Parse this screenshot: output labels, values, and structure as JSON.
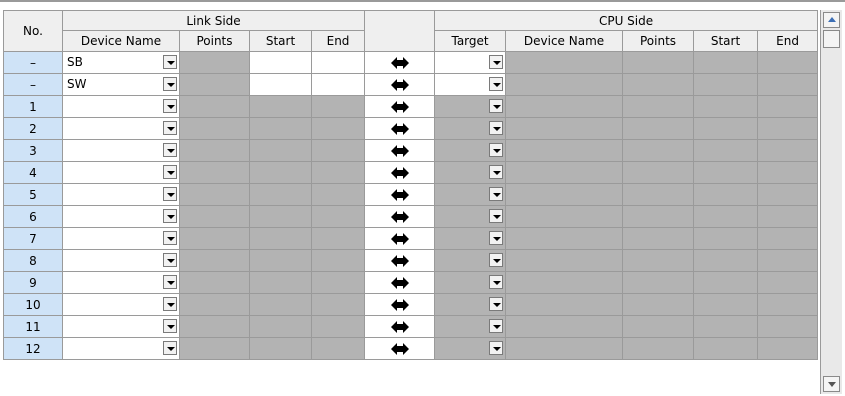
{
  "headers": {
    "no": "No.",
    "link_side": "Link Side",
    "cpu_side": "CPU Side",
    "link_cols": [
      "Device Name",
      "Points",
      "Start",
      "End"
    ],
    "cpu_cols": [
      "Target",
      "Device Name",
      "Points",
      "Start",
      "End"
    ]
  },
  "rows": [
    {
      "no": "–",
      "device": "SB"
    },
    {
      "no": "–",
      "device": "SW"
    },
    {
      "no": "1",
      "device": ""
    },
    {
      "no": "2",
      "device": ""
    },
    {
      "no": "3",
      "device": ""
    },
    {
      "no": "4",
      "device": ""
    },
    {
      "no": "5",
      "device": ""
    },
    {
      "no": "6",
      "device": ""
    },
    {
      "no": "7",
      "device": ""
    },
    {
      "no": "8",
      "device": ""
    },
    {
      "no": "9",
      "device": ""
    },
    {
      "no": "10",
      "device": ""
    },
    {
      "no": "11",
      "device": ""
    },
    {
      "no": "12",
      "device": ""
    }
  ],
  "icons": {
    "link": "bidirectional-arrow-icon",
    "dropdown": "chevron-down-icon"
  },
  "colors": {
    "no_bg": "#cfe3f7",
    "disabled": "#b3b3b3",
    "header": "#efefef",
    "arrow": "#000000"
  }
}
